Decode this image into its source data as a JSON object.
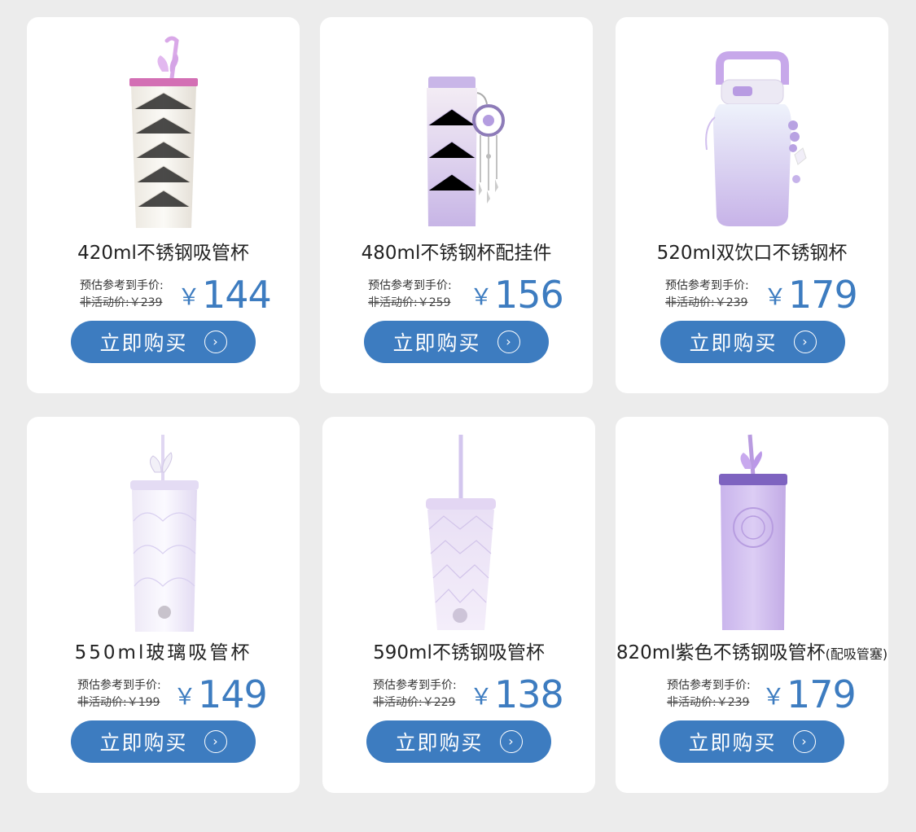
{
  "products": [
    {
      "name": "420ml不锈钢吸管杯",
      "suffix": "",
      "est_label": "预估参考到手价:",
      "orig_label": "非活动价:￥239",
      "yen": "￥",
      "price": "144",
      "buy_label": "立即购买",
      "icon": "chevron-right-circle-icon"
    },
    {
      "name": "480ml不锈钢杯配挂件",
      "suffix": "",
      "est_label": "预估参考到手价:",
      "orig_label": "非活动价:￥259",
      "yen": "￥",
      "price": "156",
      "buy_label": "立即购买",
      "icon": "chevron-right-circle-icon"
    },
    {
      "name": "520ml双饮口不锈钢杯",
      "suffix": "",
      "est_label": "预估参考到手价:",
      "orig_label": "非活动价:￥239",
      "yen": "￥",
      "price": "179",
      "buy_label": "立即购买",
      "icon": "chevron-right-circle-icon"
    },
    {
      "name": "550ml玻璃吸管杯",
      "suffix": "",
      "est_label": "预估参考到手价:",
      "orig_label": "非活动价:￥199",
      "yen": "￥",
      "price": "149",
      "buy_label": "立即购买",
      "icon": "chevron-right-circle-icon"
    },
    {
      "name": "590ml不锈钢吸管杯",
      "suffix": "",
      "est_label": "预估参考到手价:",
      "orig_label": "非活动价:￥229",
      "yen": "￥",
      "price": "138",
      "buy_label": "立即购买",
      "icon": "chevron-right-circle-icon"
    },
    {
      "name": "820ml紫色不锈钢吸管杯",
      "suffix": "(配吸管塞)",
      "est_label": "预估参考到手价:",
      "orig_label": "非活动价:￥239",
      "yen": "￥",
      "price": "179",
      "buy_label": "立即购买",
      "icon": "chevron-right-circle-icon"
    }
  ],
  "colors": {
    "background": "#ececec",
    "card": "#ffffff",
    "accent": "#3d7cc0",
    "text": "#222222"
  }
}
